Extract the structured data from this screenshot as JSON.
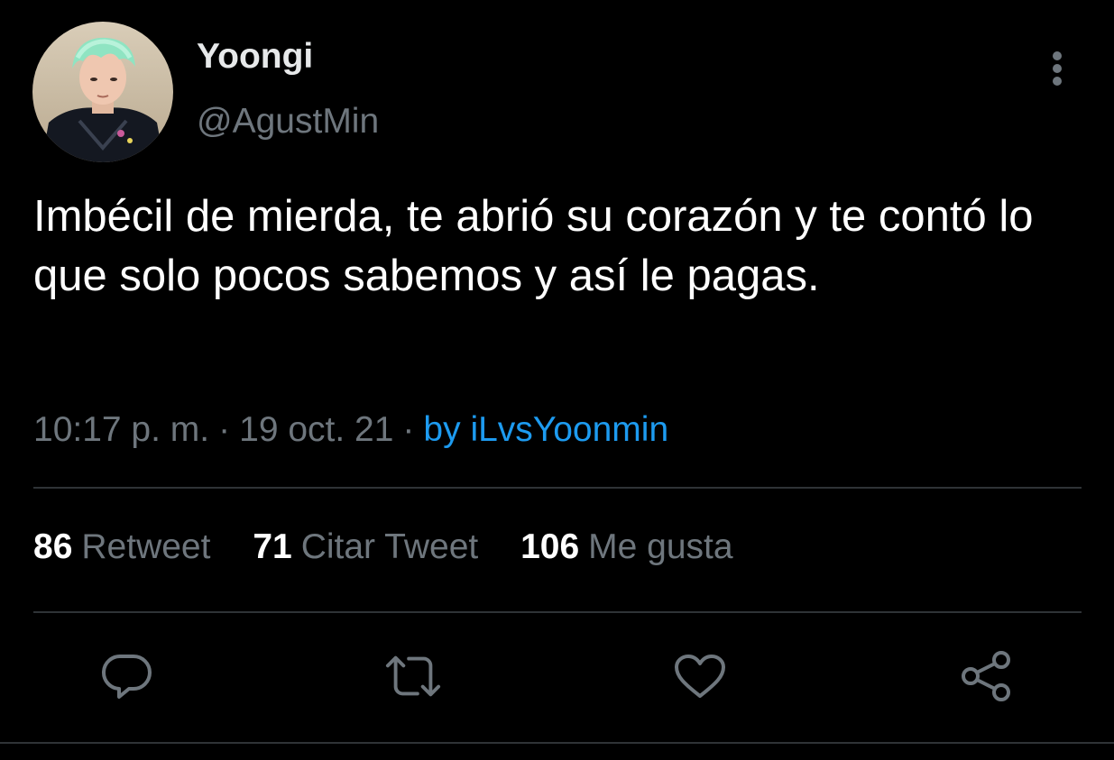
{
  "author": {
    "display_name": "Yoongi",
    "handle": "@AgustMin"
  },
  "tweet": {
    "text": "Imbécil de mierda, te abrió su corazón y te contó lo que solo pocos sabemos y así le pagas."
  },
  "meta": {
    "time": "10:17 p. m.",
    "separator": "·",
    "date": "19 oct. 21",
    "source": "by iLvsYoonmin"
  },
  "stats": {
    "retweets": {
      "count": "86",
      "label": "Retweet"
    },
    "quotes": {
      "count": "71",
      "label": "Citar Tweet"
    },
    "likes": {
      "count": "106",
      "label": "Me gusta"
    }
  },
  "icons": {
    "more": "more-vertical-icon",
    "reply": "reply-icon",
    "retweet": "retweet-icon",
    "like": "heart-icon",
    "share": "share-icon"
  },
  "colors": {
    "background": "#000000",
    "text": "#ffffff",
    "secondary": "#6e767d",
    "link": "#1d9bf0",
    "divider": "#2f3336"
  }
}
